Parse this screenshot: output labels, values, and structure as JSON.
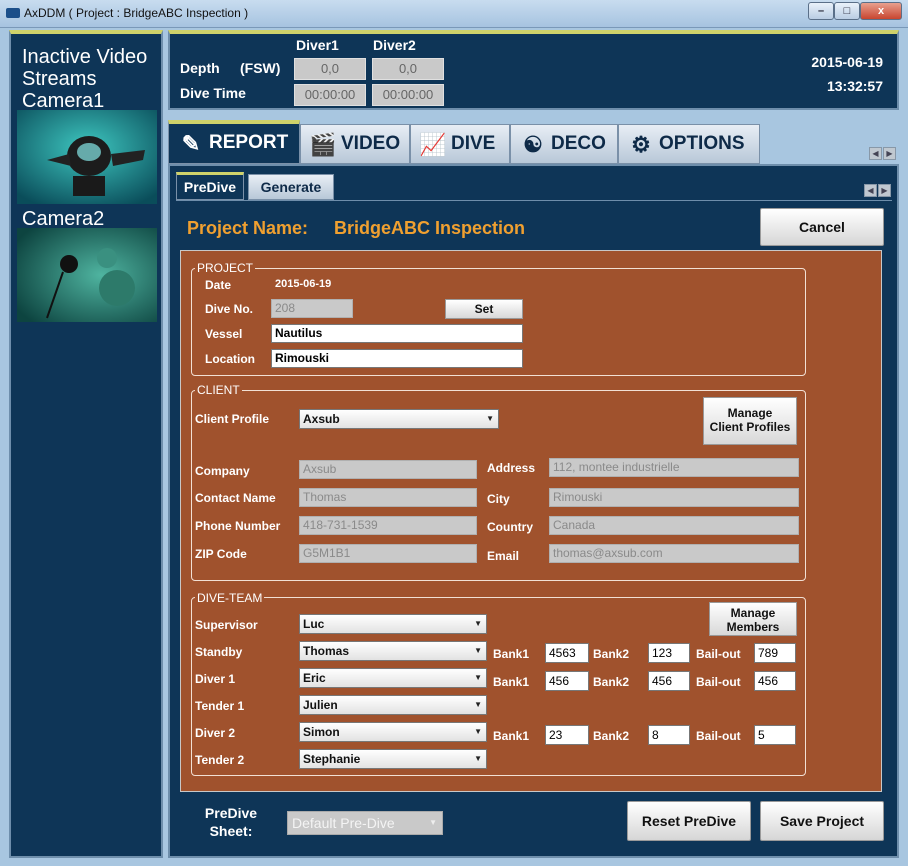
{
  "window": {
    "title": "AxDDM ( Project : BridgeABC Inspection )",
    "minimize": "–",
    "maximize": "□",
    "close": "x"
  },
  "left_panel": {
    "heading": "Inactive Video Streams",
    "camera1": "Camera1",
    "camera2": "Camera2"
  },
  "info": {
    "diver1": "Diver1",
    "diver2": "Diver2",
    "depth_label": "Depth",
    "depth_unit": "(FSW)",
    "dive_time_label": "Dive Time",
    "diver1_depth": "0,0",
    "diver2_depth": "0,0",
    "diver1_time": "00:00:00",
    "diver2_time": "00:00:00",
    "date": "2015-06-19",
    "time": "13:32:57"
  },
  "tabs": [
    {
      "label": "REPORT",
      "icon": "pencil-icon"
    },
    {
      "label": "VIDEO",
      "icon": "clapperboard-icon"
    },
    {
      "label": "DIVE",
      "icon": "graph-icon"
    },
    {
      "label": "DECO",
      "icon": "diver-icon"
    },
    {
      "label": "OPTIONS",
      "icon": "gear-icon"
    }
  ],
  "subtabs": [
    "PreDive",
    "Generate"
  ],
  "project": {
    "name_label": "Project Name:",
    "name": "BridgeABC Inspection",
    "cancel": "Cancel"
  },
  "project_group": {
    "title": "PROJECT",
    "date_label": "Date",
    "date": "2015-06-19",
    "dive_no_label": "Dive No.",
    "dive_no": "208",
    "set": "Set",
    "vessel_label": "Vessel",
    "vessel": "Nautilus",
    "location_label": "Location",
    "location": "Rimouski"
  },
  "client_group": {
    "title": "CLIENT",
    "profile_label": "Client Profile",
    "profile": "Axsub",
    "manage_line1": "Manage",
    "manage_line2": "Client Profiles",
    "company_label": "Company",
    "company": "Axsub",
    "contact_label": "Contact Name",
    "contact": "Thomas",
    "phone_label": "Phone Number",
    "phone": "418-731-1539",
    "zip_label": "ZIP Code",
    "zip": "G5M1B1",
    "address_label": "Address",
    "address": "112, montee industrielle",
    "city_label": "City",
    "city": "Rimouski",
    "country_label": "Country",
    "country": "Canada",
    "email_label": "Email",
    "email": "thomas@axsub.com"
  },
  "team_group": {
    "title": "DIVE-TEAM",
    "manage_line1": "Manage",
    "manage_line2": "Members",
    "bank1": "Bank1",
    "bank2": "Bank2",
    "bailout": "Bail-out",
    "supervisor_label": "Supervisor",
    "supervisor": "Luc",
    "standby_label": "Standby",
    "standby": "Thomas",
    "standby_bank1": "4563",
    "standby_bank2": "123",
    "standby_bailout": "789",
    "diver1_label": "Diver 1",
    "diver1": "Eric",
    "diver1_bank1": "456",
    "diver1_bank2": "456",
    "diver1_bailout": "456",
    "tender1_label": "Tender 1",
    "tender1": "Julien",
    "diver2_label": "Diver 2",
    "diver2": "Simon",
    "diver2_bank1": "23",
    "diver2_bank2": "8",
    "diver2_bailout": "5",
    "tender2_label": "Tender 2",
    "tender2": "Stephanie"
  },
  "footer": {
    "sheet_line1": "PreDive",
    "sheet_line2": "Sheet:",
    "sheet": "Default Pre-Dive",
    "reset": "Reset PreDive",
    "save": "Save Project"
  }
}
